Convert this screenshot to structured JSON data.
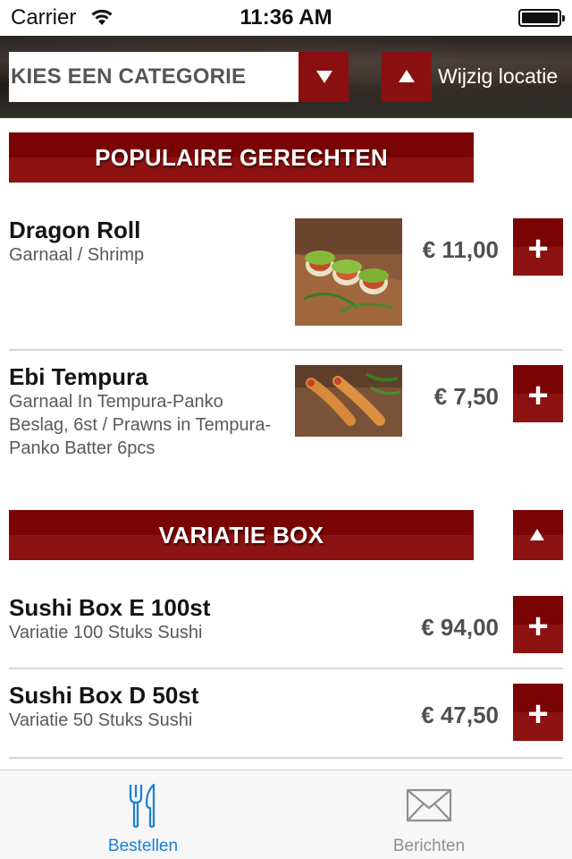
{
  "status_bar": {
    "carrier": "Carrier",
    "time": "11:36 AM"
  },
  "header": {
    "category_placeholder": "KIES EEN CATEGORIE",
    "location_label": "Wijzig locatie"
  },
  "sections": [
    {
      "title": "POPULAIRE GERECHTEN",
      "items": [
        {
          "name": "Dragon Roll",
          "description": "Garnaal / Shrimp",
          "price": "€ 11,00",
          "has_photo": true
        },
        {
          "name": "Ebi Tempura",
          "description": "Garnaal In Tempura-Panko Beslag, 6st / Prawns in Tempura-Panko Batter 6pcs",
          "price": "€ 7,50",
          "has_photo": true
        }
      ]
    },
    {
      "title": "VARIATIE BOX",
      "items": [
        {
          "name": "Sushi Box E 100st",
          "description": "Variatie 100 Stuks Sushi",
          "price": "€ 94,00",
          "has_photo": false
        },
        {
          "name": "Sushi Box D 50st",
          "description": "Variatie 50 Stuks Sushi",
          "price": "€ 47,50",
          "has_photo": false
        }
      ]
    }
  ],
  "add_label": "+",
  "tabs": [
    {
      "label": "Bestellen",
      "icon": "cutlery-icon",
      "active": true
    },
    {
      "label": "Berichten",
      "icon": "envelope-icon",
      "active": false
    }
  ],
  "colors": {
    "accent": "#8a1010",
    "tab_active": "#1a7fd8",
    "tab_inactive": "#8f8f8f"
  }
}
